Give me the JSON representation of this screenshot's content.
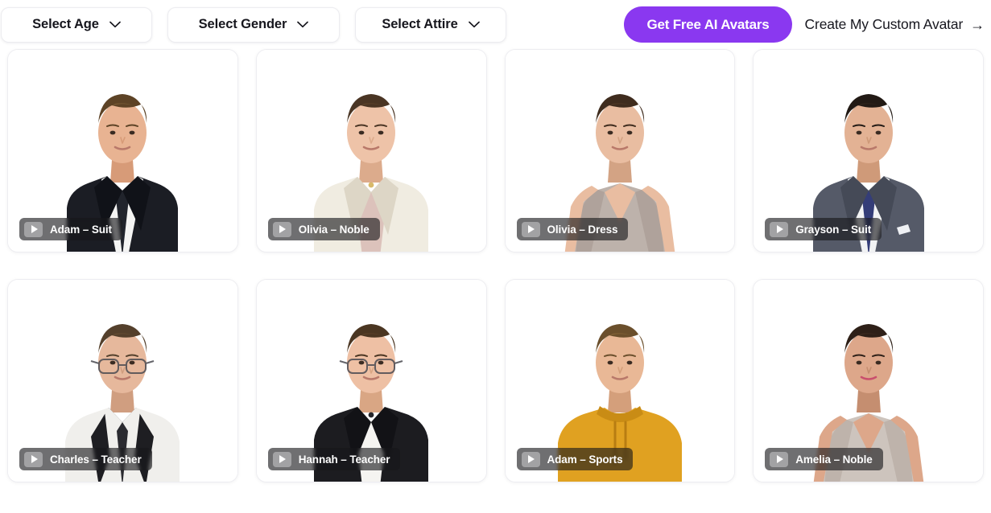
{
  "toolbar": {
    "filters": [
      {
        "label": "Select Age",
        "icon": "chevron-down-icon"
      },
      {
        "label": "Select Gender",
        "icon": "chevron-down-icon"
      },
      {
        "label": "Select Attire",
        "icon": "chevron-down-icon"
      }
    ],
    "primary_cta": "Get Free AI Avatars",
    "secondary_cta": "Create My Custom Avatar",
    "secondary_cta_arrow": "→",
    "accent_color": "#8a38f0"
  },
  "gallery": {
    "cards": [
      {
        "label": "Adam – Suit",
        "play_icon": "play-icon",
        "skin": "#e8b392",
        "skin_shadow": "#d79b78",
        "hair": "#5d4326",
        "hair_light": "#8a6a3f",
        "garment": "#1b1d24",
        "garment_dark": "#101218",
        "shirt": "#f4f4f3",
        "accent": "#21242c",
        "style": "suit"
      },
      {
        "label": "Olivia – Noble",
        "play_icon": "play-icon",
        "skin": "#eec3a8",
        "skin_shadow": "#dcab8c",
        "hair": "#4a3524",
        "hair_light": "#6b4c31",
        "garment": "#f0ece1",
        "garment_dark": "#ddd6c6",
        "shirt": "#dcc2bb",
        "accent": "#d8b96a",
        "style": "blazer"
      },
      {
        "label": "Olivia – Dress",
        "play_icon": "play-icon",
        "skin": "#e9bda1",
        "skin_shadow": "#d3a384",
        "hair": "#3f2c1e",
        "hair_light": "#5e432c",
        "garment": "#bdb2ab",
        "garment_dark": "#a79a92",
        "shirt": "#cdc3bc",
        "accent": "#9b8f87",
        "style": "dress"
      },
      {
        "label": "Grayson – Suit",
        "play_icon": "play-icon",
        "skin": "#e3b294",
        "skin_shadow": "#cf9a79",
        "hair": "#221a15",
        "hair_light": "#3c2d22",
        "garment": "#555a68",
        "garment_dark": "#454a57",
        "shirt": "#f2f3f4",
        "accent": "#343d78",
        "style": "suit"
      },
      {
        "label": "Charles – Teacher",
        "play_icon": "play-icon",
        "skin": "#e6b89c",
        "skin_shadow": "#d09e80",
        "hair": "#54402c",
        "hair_light": "#735639",
        "garment": "#1e1e22",
        "garment_dark": "#141418",
        "shirt": "#f0efec",
        "accent": "#2b2b30",
        "style": "vest"
      },
      {
        "label": "Hannah – Teacher",
        "play_icon": "play-icon",
        "skin": "#eec0a4",
        "skin_shadow": "#d9a684",
        "hair": "#4b3622",
        "hair_light": "#69492e",
        "garment": "#1c1c20",
        "garment_dark": "#121216",
        "shirt": "#f5f4f1",
        "accent": "#26262b",
        "style": "blazer"
      },
      {
        "label": "Adam – Sports",
        "play_icon": "play-icon",
        "skin": "#e9b896",
        "skin_shadow": "#d49f7b",
        "hair": "#6b4f2c",
        "hair_light": "#94713f",
        "garment": "#e0a121",
        "garment_dark": "#c98c15",
        "shirt": "#e0a121",
        "accent": "#b87d12",
        "style": "hoodie"
      },
      {
        "label": "Amelia – Noble",
        "play_icon": "play-icon",
        "skin": "#dda78a",
        "skin_shadow": "#c58e70",
        "hair": "#2e2018",
        "hair_light": "#4a3426",
        "garment": "#cdc4bd",
        "garment_dark": "#b5aaa2",
        "shirt": "#d6ccc5",
        "accent": "#c94f6d",
        "style": "dress"
      }
    ]
  }
}
